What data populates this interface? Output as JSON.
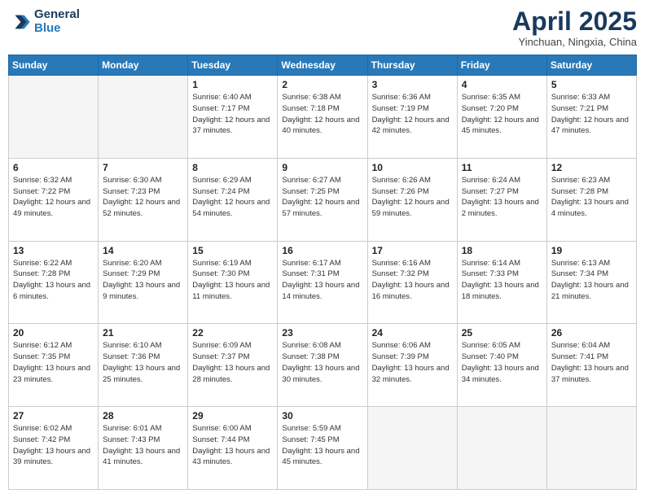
{
  "header": {
    "logo_line1": "General",
    "logo_line2": "Blue",
    "month_title": "April 2025",
    "location": "Yinchuan, Ningxia, China"
  },
  "days_of_week": [
    "Sunday",
    "Monday",
    "Tuesday",
    "Wednesday",
    "Thursday",
    "Friday",
    "Saturday"
  ],
  "weeks": [
    [
      {
        "day": "",
        "info": ""
      },
      {
        "day": "",
        "info": ""
      },
      {
        "day": "1",
        "info": "Sunrise: 6:40 AM\nSunset: 7:17 PM\nDaylight: 12 hours\nand 37 minutes."
      },
      {
        "day": "2",
        "info": "Sunrise: 6:38 AM\nSunset: 7:18 PM\nDaylight: 12 hours\nand 40 minutes."
      },
      {
        "day": "3",
        "info": "Sunrise: 6:36 AM\nSunset: 7:19 PM\nDaylight: 12 hours\nand 42 minutes."
      },
      {
        "day": "4",
        "info": "Sunrise: 6:35 AM\nSunset: 7:20 PM\nDaylight: 12 hours\nand 45 minutes."
      },
      {
        "day": "5",
        "info": "Sunrise: 6:33 AM\nSunset: 7:21 PM\nDaylight: 12 hours\nand 47 minutes."
      }
    ],
    [
      {
        "day": "6",
        "info": "Sunrise: 6:32 AM\nSunset: 7:22 PM\nDaylight: 12 hours\nand 49 minutes."
      },
      {
        "day": "7",
        "info": "Sunrise: 6:30 AM\nSunset: 7:23 PM\nDaylight: 12 hours\nand 52 minutes."
      },
      {
        "day": "8",
        "info": "Sunrise: 6:29 AM\nSunset: 7:24 PM\nDaylight: 12 hours\nand 54 minutes."
      },
      {
        "day": "9",
        "info": "Sunrise: 6:27 AM\nSunset: 7:25 PM\nDaylight: 12 hours\nand 57 minutes."
      },
      {
        "day": "10",
        "info": "Sunrise: 6:26 AM\nSunset: 7:26 PM\nDaylight: 12 hours\nand 59 minutes."
      },
      {
        "day": "11",
        "info": "Sunrise: 6:24 AM\nSunset: 7:27 PM\nDaylight: 13 hours\nand 2 minutes."
      },
      {
        "day": "12",
        "info": "Sunrise: 6:23 AM\nSunset: 7:28 PM\nDaylight: 13 hours\nand 4 minutes."
      }
    ],
    [
      {
        "day": "13",
        "info": "Sunrise: 6:22 AM\nSunset: 7:28 PM\nDaylight: 13 hours\nand 6 minutes."
      },
      {
        "day": "14",
        "info": "Sunrise: 6:20 AM\nSunset: 7:29 PM\nDaylight: 13 hours\nand 9 minutes."
      },
      {
        "day": "15",
        "info": "Sunrise: 6:19 AM\nSunset: 7:30 PM\nDaylight: 13 hours\nand 11 minutes."
      },
      {
        "day": "16",
        "info": "Sunrise: 6:17 AM\nSunset: 7:31 PM\nDaylight: 13 hours\nand 14 minutes."
      },
      {
        "day": "17",
        "info": "Sunrise: 6:16 AM\nSunset: 7:32 PM\nDaylight: 13 hours\nand 16 minutes."
      },
      {
        "day": "18",
        "info": "Sunrise: 6:14 AM\nSunset: 7:33 PM\nDaylight: 13 hours\nand 18 minutes."
      },
      {
        "day": "19",
        "info": "Sunrise: 6:13 AM\nSunset: 7:34 PM\nDaylight: 13 hours\nand 21 minutes."
      }
    ],
    [
      {
        "day": "20",
        "info": "Sunrise: 6:12 AM\nSunset: 7:35 PM\nDaylight: 13 hours\nand 23 minutes."
      },
      {
        "day": "21",
        "info": "Sunrise: 6:10 AM\nSunset: 7:36 PM\nDaylight: 13 hours\nand 25 minutes."
      },
      {
        "day": "22",
        "info": "Sunrise: 6:09 AM\nSunset: 7:37 PM\nDaylight: 13 hours\nand 28 minutes."
      },
      {
        "day": "23",
        "info": "Sunrise: 6:08 AM\nSunset: 7:38 PM\nDaylight: 13 hours\nand 30 minutes."
      },
      {
        "day": "24",
        "info": "Sunrise: 6:06 AM\nSunset: 7:39 PM\nDaylight: 13 hours\nand 32 minutes."
      },
      {
        "day": "25",
        "info": "Sunrise: 6:05 AM\nSunset: 7:40 PM\nDaylight: 13 hours\nand 34 minutes."
      },
      {
        "day": "26",
        "info": "Sunrise: 6:04 AM\nSunset: 7:41 PM\nDaylight: 13 hours\nand 37 minutes."
      }
    ],
    [
      {
        "day": "27",
        "info": "Sunrise: 6:02 AM\nSunset: 7:42 PM\nDaylight: 13 hours\nand 39 minutes."
      },
      {
        "day": "28",
        "info": "Sunrise: 6:01 AM\nSunset: 7:43 PM\nDaylight: 13 hours\nand 41 minutes."
      },
      {
        "day": "29",
        "info": "Sunrise: 6:00 AM\nSunset: 7:44 PM\nDaylight: 13 hours\nand 43 minutes."
      },
      {
        "day": "30",
        "info": "Sunrise: 5:59 AM\nSunset: 7:45 PM\nDaylight: 13 hours\nand 45 minutes."
      },
      {
        "day": "",
        "info": ""
      },
      {
        "day": "",
        "info": ""
      },
      {
        "day": "",
        "info": ""
      }
    ]
  ]
}
